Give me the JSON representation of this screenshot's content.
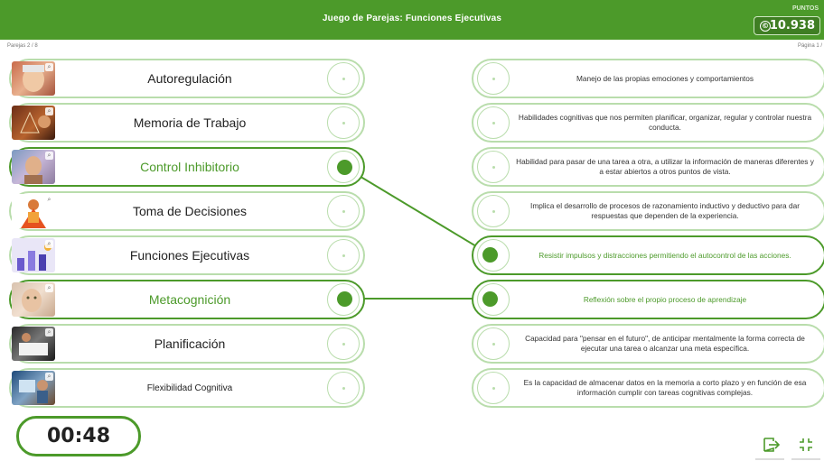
{
  "header": {
    "title": "Juego de Parejas: Funciones Ejecutivas",
    "points_label": "PUNTOS",
    "points_value": "10.938",
    "coin_symbol": "©"
  },
  "status": {
    "pairs": "Parejas 2 / 8",
    "page": "Página 1 /"
  },
  "concepts": [
    {
      "label": "Autoregulación",
      "matched": false
    },
    {
      "label": "Memoria de Trabajo",
      "matched": false
    },
    {
      "label": "Control Inhibitorio",
      "matched": true
    },
    {
      "label": "Toma de Decisiones",
      "matched": false
    },
    {
      "label": "Funciones Ejecutivas",
      "matched": false
    },
    {
      "label": "Metacognición",
      "matched": true
    },
    {
      "label": "Planificación",
      "matched": false
    },
    {
      "label": "Flexibilidad Cognitiva",
      "matched": false
    }
  ],
  "definitions": [
    {
      "text": "Manejo de las propias emociones y comportamientos",
      "matched": false
    },
    {
      "text": "Habilidades cognitivas que nos permiten planificar, organizar, regular y controlar nuestra conducta.",
      "matched": false
    },
    {
      "text": "Habilidad para pasar de una tarea a otra, a utilizar la información de maneras diferentes y a estar abiertos a otros puntos de vista.",
      "matched": false
    },
    {
      "text": "Implica el desarrollo de procesos de razonamiento inductivo y deductivo para dar respuestas que dependen de la experiencia.",
      "matched": false
    },
    {
      "text": "Resistir impulsos y distracciones permitiendo el autocontrol de las acciones.",
      "matched": true
    },
    {
      "text": "Reflexión sobre el propio proceso de aprendizaje",
      "matched": true
    },
    {
      "text": "Capacidad para \"pensar en el futuro\", de anticipar mentalmente la forma correcta de ejecutar una tarea o alcanzar una meta específica.",
      "matched": false
    },
    {
      "text": "Es la capacidad de almacenar datos en la memoria a corto plazo y en función de esa información cumplir con tareas cognitivas complejas.",
      "matched": false
    }
  ],
  "matches": [
    {
      "concept": "Control Inhibitorio",
      "definition": "Resistir impulsos y distracciones permitiendo el autocontrol de las acciones."
    },
    {
      "concept": "Metacognición",
      "definition": "Reflexión sobre el propio proceso de aprendizaje"
    }
  ],
  "timer": "00:48",
  "toolbar": {
    "exit_icon": "exit-icon",
    "collapse_icon": "collapse-icon"
  },
  "colors": {
    "accent": "#4c9a2a",
    "border_light": "#b9ddac"
  }
}
